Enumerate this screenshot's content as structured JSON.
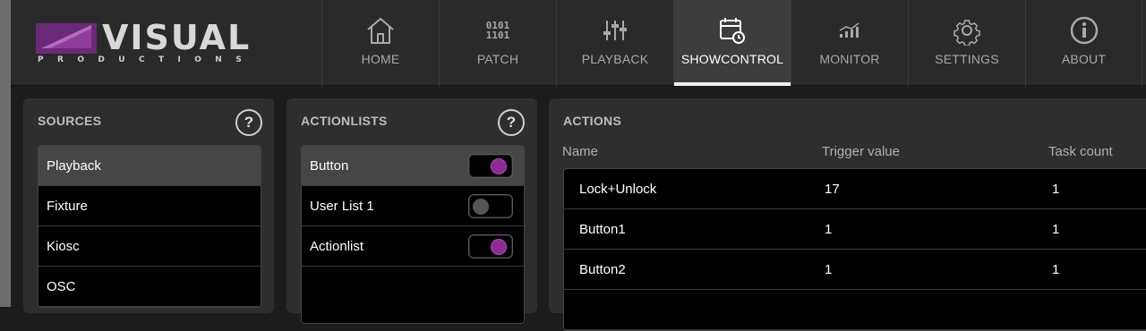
{
  "logo": {
    "word": "VISUAL",
    "sub": "PRODUCTIONS"
  },
  "nav": [
    {
      "label": "HOME",
      "icon": "home-icon"
    },
    {
      "label": "PATCH",
      "icon": "binary-icon",
      "glyph1": "0101",
      "glyph2": "1101"
    },
    {
      "label": "PLAYBACK",
      "icon": "sliders-icon"
    },
    {
      "label": "SHOWCONTROL",
      "icon": "calendar-clock-icon",
      "active": true
    },
    {
      "label": "MONITOR",
      "icon": "signal-chart-icon"
    },
    {
      "label": "SETTINGS",
      "icon": "gear-icon"
    },
    {
      "label": "ABOUT",
      "icon": "info-icon"
    }
  ],
  "sources": {
    "title": "SOURCES",
    "help": "?",
    "items": [
      "Playback",
      "Fixture",
      "Kiosc",
      "OSC"
    ]
  },
  "actionlists": {
    "title": "ACTIONLISTS",
    "help": "?",
    "items": [
      {
        "label": "Button",
        "enabled": true
      },
      {
        "label": "User List 1",
        "enabled": false
      },
      {
        "label": "Actionlist",
        "enabled": true
      }
    ]
  },
  "actions": {
    "title": "ACTIONS",
    "columns": [
      "Name",
      "Trigger value",
      "Task count"
    ],
    "rows": [
      [
        "Lock+Unlock",
        "17",
        "1"
      ],
      [
        "Button1",
        "1",
        "1"
      ],
      [
        "Button2",
        "1",
        "1"
      ]
    ]
  },
  "colors": {
    "accent": "#8e2a96",
    "logo_purple": "#7a2f86"
  }
}
